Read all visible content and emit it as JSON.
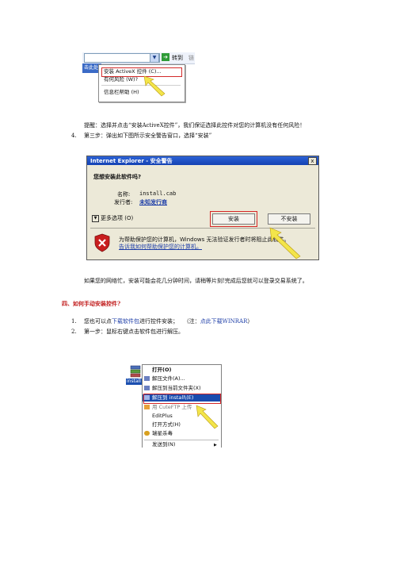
{
  "shot1": {
    "go_label": "转到",
    "links_label": "链",
    "infobar_text": "击此处安装",
    "menu_items": [
      "安装 ActiveX 控件 (C)...",
      "有何风险 (W)?",
      "信息栏帮助 (H)"
    ]
  },
  "tip": "提醒：选择并点击“安装ActiveX控件”，我们保证选择此控件对您的计算机没有任何风险！",
  "step4": {
    "num": "4.",
    "text": "第三步：弹出如下图所示安全警告窗口，选择“安装”"
  },
  "dialog": {
    "title": "Internet Explorer - 安全警告",
    "close": "x",
    "question": "您想安装此软件吗?",
    "name_label": "名称:",
    "name_value": "install.cab",
    "publisher_label": "发行者:",
    "publisher_value": "未知发行商",
    "more_options": "更多选项 (O)",
    "more_icon": "chevron-down-icon",
    "install": "安装",
    "dont_install": "不安装",
    "warning_text": "为帮助保护您的计算机，Windows 无法验证发行者时将阻止此软件。",
    "warning_link": "告诉我如何帮助保护您的计算机。"
  },
  "busy_note": "如果您的网络忙，安装可能会花几分钟时间，请稍等片刻!完成后您就可以登录交易系统了。",
  "section_heading": "四、如何手动安装控件?",
  "items": [
    {
      "num": "1.",
      "pre": "您也可以点",
      "link1": "下载软件包",
      "mid": "进行控件安装；",
      "note_open": "（注：",
      "link2": "点此下载WINRAR",
      "note_close": "）"
    },
    {
      "num": "2.",
      "text": "第一步：鼠标右键点击软件包进行解压。"
    }
  ],
  "context_menu": {
    "file_label": "install",
    "items": [
      "打开(O)",
      "解压文件(A)...",
      "解压到当前文件夹(X)",
      "解压到 install\\(E)",
      "用 CuteFTP 上传",
      "EditPlus",
      "打开方式(H)",
      "瑞星杀毒",
      "发送到(N)"
    ]
  },
  "colors": {
    "highlight_red": "#d52626",
    "link_blue": "#1f3fa8",
    "heading_red": "#c01818",
    "arrow_yellow": "#f3e54a"
  }
}
